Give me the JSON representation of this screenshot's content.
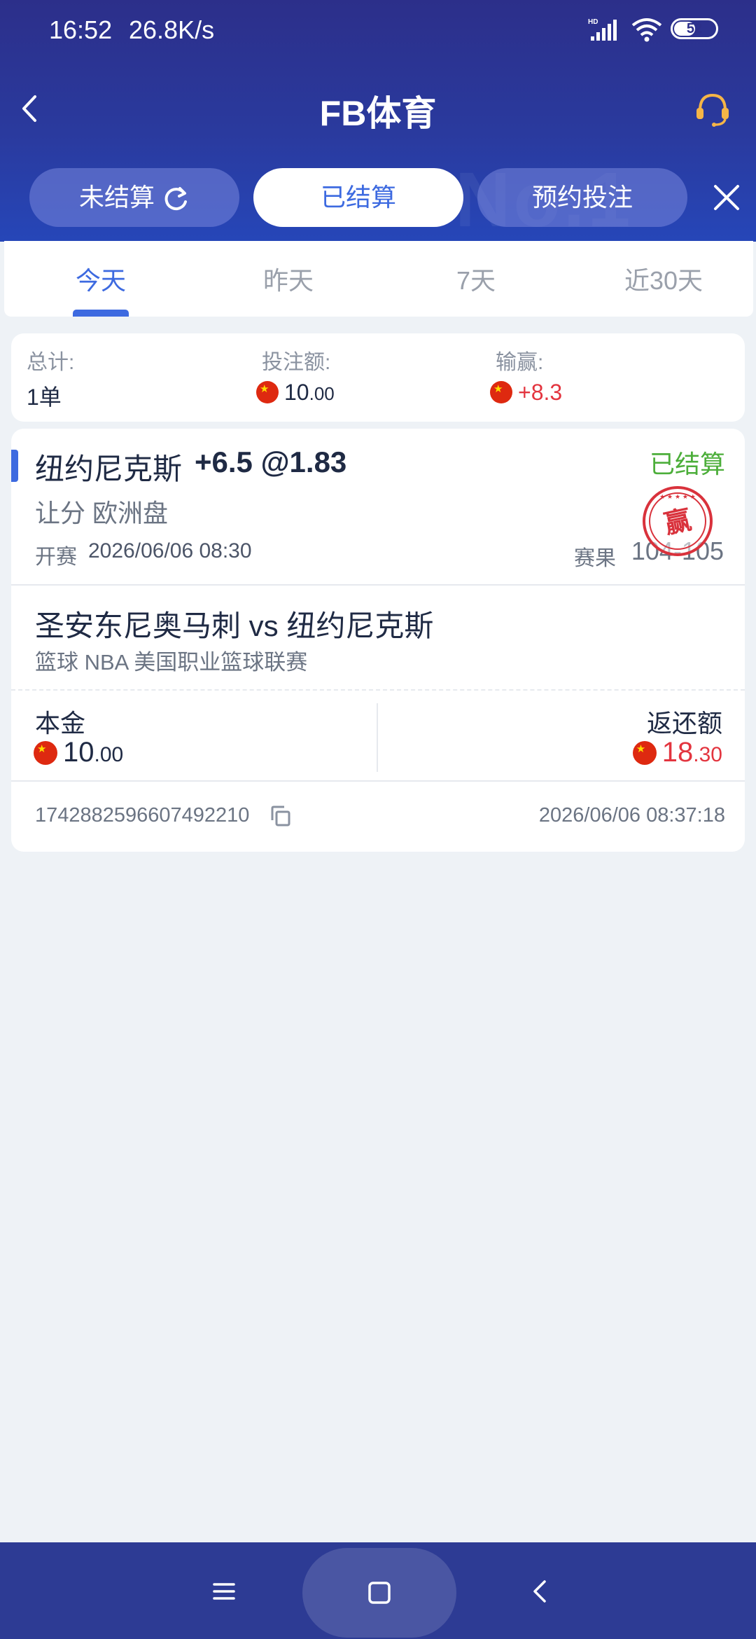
{
  "status_bar": {
    "time": "16:52",
    "speed": "26.8K/s",
    "battery": "52",
    "battery_level": 0.52
  },
  "header": {
    "title": "FB体育"
  },
  "segments": [
    {
      "label": "未结算"
    },
    {
      "label": "已结算"
    },
    {
      "label": "预约投注"
    }
  ],
  "watermark": "No.1",
  "date_tabs": [
    "今天",
    "昨天",
    "7天",
    "近30天"
  ],
  "summary": {
    "total_label": "总计:",
    "total_value": "1单",
    "stake_label": "投注额:",
    "stake_int": "10",
    "stake_dec": ".00",
    "winloss_label": "输赢:",
    "winloss_value": "+8.3"
  },
  "bet": {
    "team": "纽约尼克斯",
    "odds": "+6.5 @1.83",
    "status": "已结算",
    "market": "让分 欧洲盘",
    "kickoff_label": "开赛",
    "kickoff_time": "2026/06/06 08:30",
    "result_label": "赛果",
    "result_value": "104-105",
    "stamp_text": "赢",
    "match": "圣安东尼奥马刺 vs 纽约尼克斯",
    "league": "篮球   NBA 美国职业篮球联赛",
    "stake_label": "本金",
    "stake_int": "10",
    "stake_dec": ".00",
    "return_label": "返还额",
    "return_int": "18",
    "return_dec": ".30",
    "order_no": "1742882596607492210",
    "order_time": "2026/06/06 08:37:18"
  },
  "colors": {
    "accent": "#3d6ae0",
    "win_red": "#e3353f",
    "settled_green": "#4cae3a",
    "header_bg": "#2c2f8a"
  }
}
